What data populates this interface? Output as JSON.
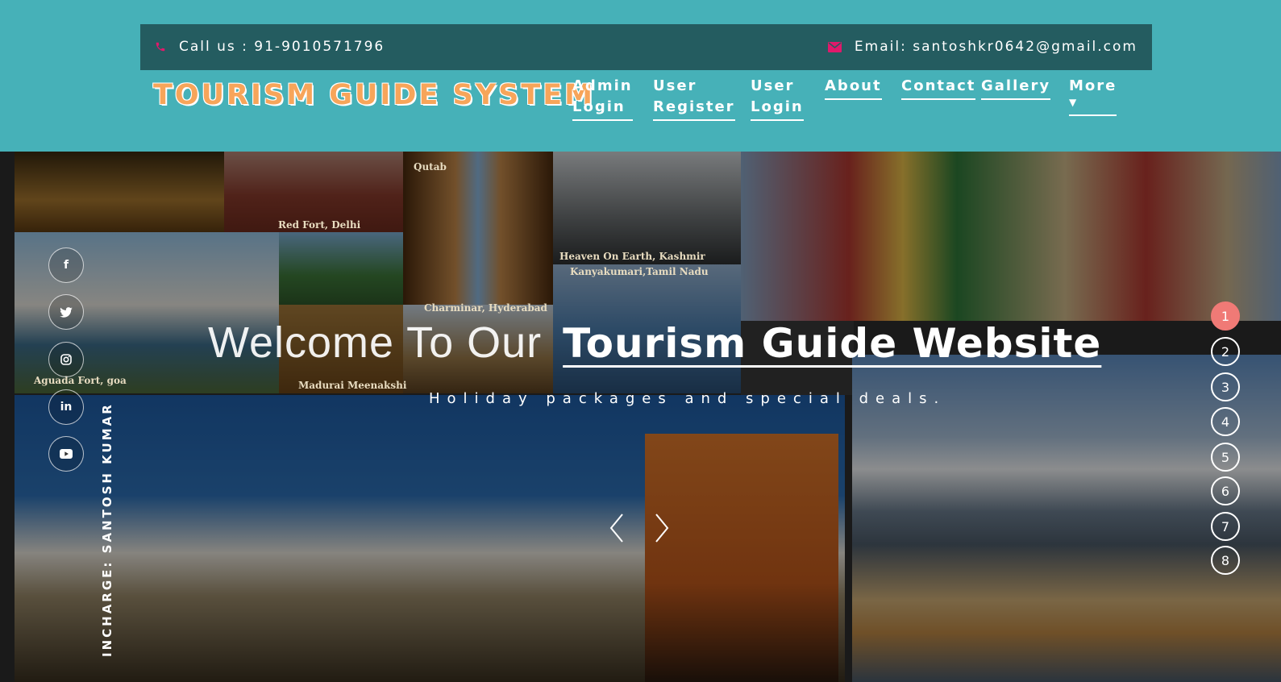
{
  "topbar": {
    "call_text": "Call us : 91-9010571796",
    "email_text": "Email: santoshkr0642@gmail.com"
  },
  "brand": "TOURISM GUIDE SYSTEM",
  "nav": [
    {
      "line1": "Admin",
      "line2": "Login"
    },
    {
      "line1": "User",
      "line2": "Register"
    },
    {
      "line1": "User",
      "line2": "Login"
    },
    {
      "line1": "About",
      "line2": ""
    },
    {
      "line1": "Contact",
      "line2": ""
    },
    {
      "line1": "Gallery",
      "line2": ""
    },
    {
      "line1": "More",
      "line2": ""
    }
  ],
  "hero": {
    "welcome_thin": "Welcome To Our",
    "welcome_bold": "Tourism Guide Website",
    "tagline": "Holiday packages and special deals.",
    "incharge": "INCHARGE: SANTOSH KUMAR",
    "photo_captions": [
      "Red Fort, Delhi",
      "Qutab",
      "Heaven On Earth, Kashmir",
      "Kanyakumari,Tamil Nadu",
      "Charminar, Hyderabad",
      "Aguada Fort, goa",
      "Madurai Meenakshi"
    ]
  },
  "social_icons": [
    "facebook-icon",
    "twitter-icon",
    "instagram-icon",
    "linkedin-icon",
    "youtube-icon"
  ],
  "slide_dots": [
    "1",
    "2",
    "3",
    "4",
    "5",
    "6",
    "7",
    "8"
  ],
  "colors": {
    "header_bg": "#46b1b8",
    "topbar_bg": "#245c60",
    "brand": "#f7a55a",
    "accent": "#e0196b",
    "active_dot": "#f07a76"
  }
}
